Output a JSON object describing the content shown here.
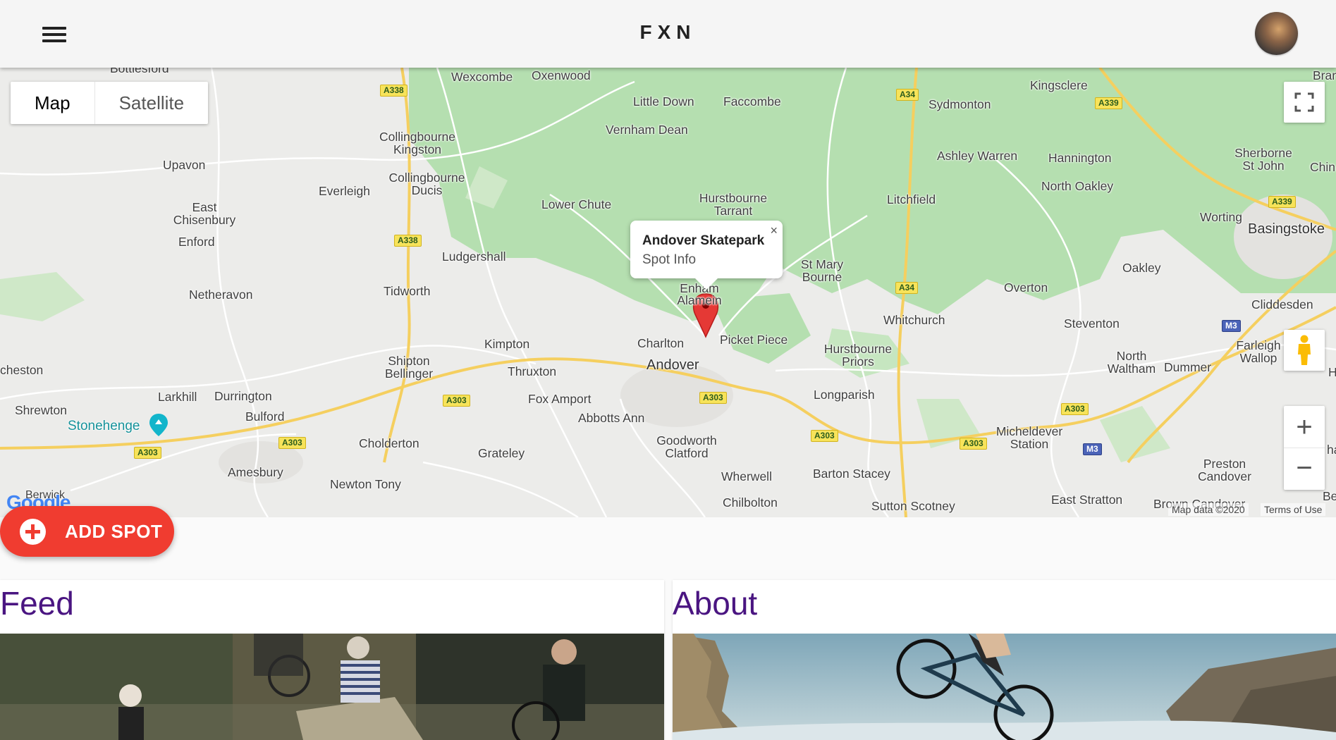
{
  "app": {
    "title": "FXN"
  },
  "map": {
    "map_type_tabs": [
      {
        "label": "Map",
        "active": true
      },
      {
        "label": "Satellite",
        "active": false
      }
    ],
    "places": [
      {
        "label": "Wexcombe"
      },
      {
        "label": "Oxenwood"
      },
      {
        "label": "Little Down"
      },
      {
        "label": "Faccombe"
      },
      {
        "label": "Vernham Dean"
      },
      {
        "label": "Sydmonton"
      },
      {
        "label": "Kingsclere"
      },
      {
        "label": "Collingbourne Kingston"
      },
      {
        "label": "Upavon"
      },
      {
        "label": "Everleigh"
      },
      {
        "label": "Collingbourne Ducis"
      },
      {
        "label": "East Chisenbury"
      },
      {
        "label": "Enford"
      },
      {
        "label": "Ashley Warren"
      },
      {
        "label": "Hannington"
      },
      {
        "label": "North Oakley"
      },
      {
        "label": "Sherborne St John"
      },
      {
        "label": "Chin"
      },
      {
        "label": "Lower Chute"
      },
      {
        "label": "Hurstbourne Tarrant"
      },
      {
        "label": "Litchfield"
      },
      {
        "label": "Worting"
      },
      {
        "label": "Basingstoke"
      },
      {
        "label": "Ludgershall"
      },
      {
        "label": "St Mary Bourne"
      },
      {
        "label": "Oakley"
      },
      {
        "label": "Netheravon"
      },
      {
        "label": "Tidworth"
      },
      {
        "label": "Enham Alamein"
      },
      {
        "label": "Overton"
      },
      {
        "label": "Cliddesden"
      },
      {
        "label": "Whitchurch"
      },
      {
        "label": "Steventon"
      },
      {
        "label": "Kimpton"
      },
      {
        "label": "Charlton"
      },
      {
        "label": "Picket Piece"
      },
      {
        "label": "Hurstbourne Priors"
      },
      {
        "label": "Farleigh Wallop"
      },
      {
        "label": "Shipton Bellinger"
      },
      {
        "label": "Thruxton"
      },
      {
        "label": "Andover"
      },
      {
        "label": "North Waltham"
      },
      {
        "label": "Dummer"
      },
      {
        "label": "cheston"
      },
      {
        "label": "Larkhill"
      },
      {
        "label": "Durrington"
      },
      {
        "label": "Fox Amport"
      },
      {
        "label": "Longparish"
      },
      {
        "label": "Shrewton"
      },
      {
        "label": "Bulford"
      },
      {
        "label": "Abbotts Ann"
      },
      {
        "label": "Stonehenge"
      },
      {
        "label": "Micheldever Station"
      },
      {
        "label": "Cholderton"
      },
      {
        "label": "Goodworth Clatford"
      },
      {
        "label": "Grateley"
      },
      {
        "label": "Preston Candover"
      },
      {
        "label": "Amesbury"
      },
      {
        "label": "Barton Stacey"
      },
      {
        "label": "Newton Tony"
      },
      {
        "label": "Wherwell"
      },
      {
        "label": "Chilbolton"
      },
      {
        "label": "Sutton Scotney"
      },
      {
        "label": "East Stratton"
      },
      {
        "label": "Berwick"
      },
      {
        "label": "Brown Candover"
      },
      {
        "label": "Brar"
      },
      {
        "label": "Bottlesford"
      },
      {
        "label": "Be"
      },
      {
        "label": "ha"
      },
      {
        "label": "H"
      }
    ],
    "road_shields": [
      {
        "label": "A338"
      },
      {
        "label": "A34"
      },
      {
        "label": "A339"
      },
      {
        "label": "A339"
      },
      {
        "label": "A338"
      },
      {
        "label": "A34"
      },
      {
        "label": "M3"
      },
      {
        "label": "A303"
      },
      {
        "label": "A303"
      },
      {
        "label": "A303"
      },
      {
        "label": "A303"
      },
      {
        "label": "A303"
      },
      {
        "label": "A303"
      },
      {
        "label": "A303"
      },
      {
        "label": "M3"
      }
    ],
    "info_window": {
      "title": "Andover Skatepark",
      "subtitle": "Spot Info",
      "close_glyph": "×"
    },
    "attribution": {
      "map_data": "Map data ©2020",
      "terms": "Terms of Use"
    },
    "logo_text": "Google",
    "zoom_in": "+",
    "zoom_out": "−",
    "colors": {
      "forest": "#b5dfb0",
      "land": "#ececea",
      "road_major": "#f7d76d",
      "marker": "#e53935"
    }
  },
  "fab": {
    "label": "ADD SPOT",
    "icon": "add-circle-icon"
  },
  "cards": [
    {
      "title": "Feed"
    },
    {
      "title": "About"
    }
  ],
  "icons": {
    "menu": "menu-icon",
    "avatar": "profile-avatar",
    "fullscreen": "fullscreen-icon",
    "pegman": "pegman-icon",
    "marker": "map-marker-icon"
  }
}
